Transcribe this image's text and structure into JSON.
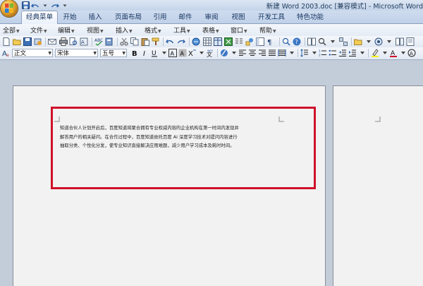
{
  "window": {
    "title": "新建 Word 2003.doc [兼容模式] - Microsoft Word"
  },
  "ribbon_tabs": [
    {
      "label": "经典菜单",
      "active": true
    },
    {
      "label": "开始"
    },
    {
      "label": "插入"
    },
    {
      "label": "页面布局"
    },
    {
      "label": "引用"
    },
    {
      "label": "邮件"
    },
    {
      "label": "审阅"
    },
    {
      "label": "视图"
    },
    {
      "label": "开发工具"
    },
    {
      "label": "特色功能"
    }
  ],
  "menus": [
    {
      "label": "全部"
    },
    {
      "label": "文件"
    },
    {
      "label": "编辑"
    },
    {
      "label": "视图"
    },
    {
      "label": "插入"
    },
    {
      "label": "格式"
    },
    {
      "label": "工具"
    },
    {
      "label": "表格"
    },
    {
      "label": "窗口"
    },
    {
      "label": "帮助"
    }
  ],
  "formatting": {
    "style": "正文",
    "font": "宋体",
    "size": "五号"
  },
  "document": {
    "lines": [
      "知道合伙人计划开启后，百度知道将聚合拥有专业权威内容的企业机构在第一时间内发现并",
      "解答用户的相关疑问。在合作过程中，百度知道依托百度 AI 深度学习技术对提问内容进行",
      "抽取分类、个性化分发，使专业知识直接解决应用难题，减少用户学习成本及耗时时间。"
    ]
  },
  "colors": {
    "highlight_border": "#d0102a",
    "ribbon_blue": "#c4d4e9"
  }
}
